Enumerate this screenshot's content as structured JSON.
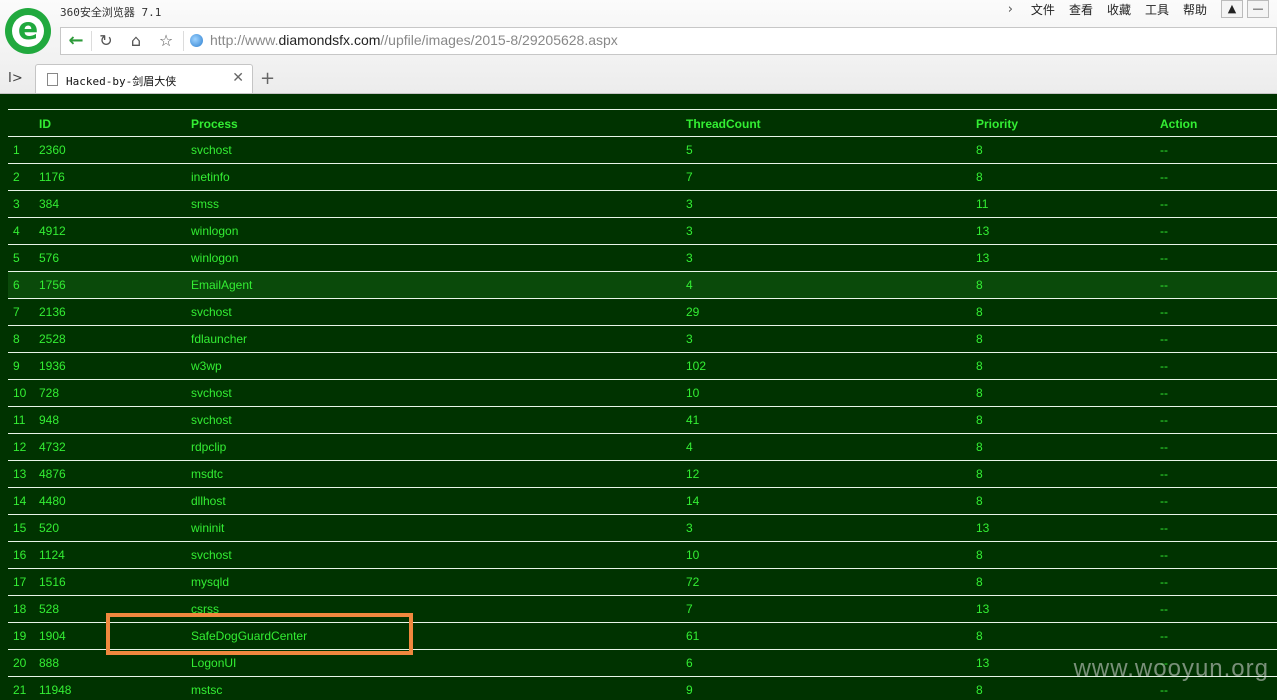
{
  "window": {
    "app_title": "360安全浏览器 7.1"
  },
  "menu": {
    "items": [
      "文件",
      "查看",
      "收藏",
      "工具",
      "帮助"
    ],
    "chevron_icon": "chevron-right-icon",
    "skin_icon": "shirt-icon"
  },
  "address_bar": {
    "url_prefix": "http://www.",
    "url_domain": "diamondsfx.com",
    "url_path": "//upfile/images/2015-8/29205628.aspx"
  },
  "tab": {
    "title": "Hacked-by-剑眉大侠",
    "close_icon": "close-icon"
  },
  "table": {
    "headers": [
      "",
      "ID",
      "Process",
      "ThreadCount",
      "Priority",
      "Action"
    ],
    "rows": [
      [
        "1",
        "2360",
        "svchost",
        "5",
        "8",
        "--"
      ],
      [
        "2",
        "1176",
        "inetinfo",
        "7",
        "8",
        "--"
      ],
      [
        "3",
        "384",
        "smss",
        "3",
        "11",
        "--"
      ],
      [
        "4",
        "4912",
        "winlogon",
        "3",
        "13",
        "--"
      ],
      [
        "5",
        "576",
        "winlogon",
        "3",
        "13",
        "--"
      ],
      [
        "6",
        "1756",
        "EmailAgent",
        "4",
        "8",
        "--"
      ],
      [
        "7",
        "2136",
        "svchost",
        "29",
        "8",
        "--"
      ],
      [
        "8",
        "2528",
        "fdlauncher",
        "3",
        "8",
        "--"
      ],
      [
        "9",
        "1936",
        "w3wp",
        "102",
        "8",
        "--"
      ],
      [
        "10",
        "728",
        "svchost",
        "10",
        "8",
        "--"
      ],
      [
        "11",
        "948",
        "svchost",
        "41",
        "8",
        "--"
      ],
      [
        "12",
        "4732",
        "rdpclip",
        "4",
        "8",
        "--"
      ],
      [
        "13",
        "4876",
        "msdtc",
        "12",
        "8",
        "--"
      ],
      [
        "14",
        "4480",
        "dllhost",
        "14",
        "8",
        "--"
      ],
      [
        "15",
        "520",
        "wininit",
        "3",
        "13",
        "--"
      ],
      [
        "16",
        "1124",
        "svchost",
        "10",
        "8",
        "--"
      ],
      [
        "17",
        "1516",
        "mysqld",
        "72",
        "8",
        "--"
      ],
      [
        "18",
        "528",
        "csrss",
        "7",
        "13",
        "--"
      ],
      [
        "19",
        "1904",
        "SafeDogGuardCenter",
        "61",
        "8",
        "--"
      ],
      [
        "20",
        "888",
        "LogonUI",
        "6",
        "13",
        "--"
      ],
      [
        "21",
        "11948",
        "mstsc",
        "9",
        "8",
        "--"
      ]
    ],
    "highlighted_row_index": 5
  },
  "watermark": "www.wooyun.org",
  "colors": {
    "page_bg": "#003300",
    "text": "#33ee33",
    "highlight_row": "#0a4a0a",
    "annotation_box": "#f0883e",
    "logo": "#21a93e"
  }
}
